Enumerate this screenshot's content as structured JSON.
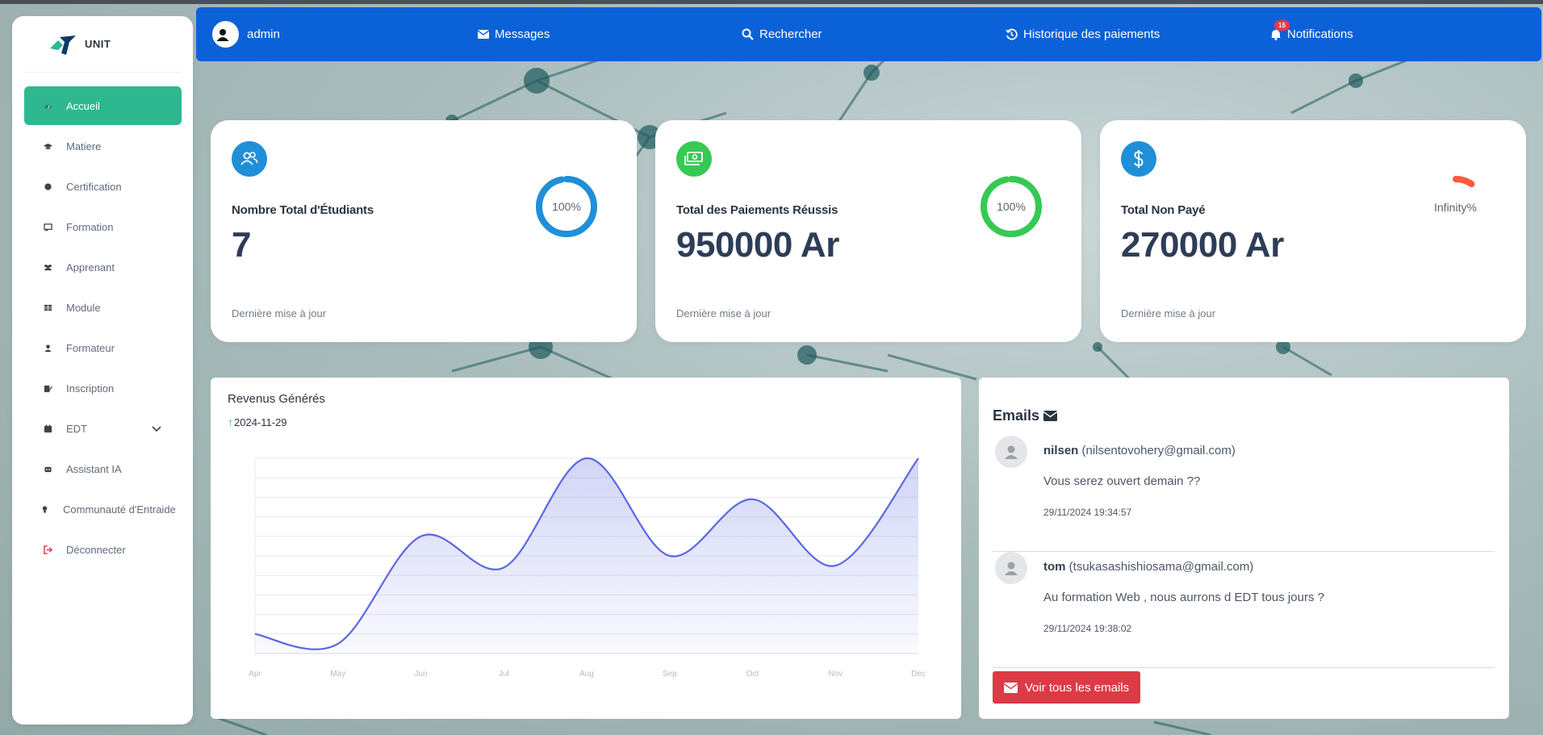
{
  "app": {
    "brand": "UNIT"
  },
  "sidebar": {
    "items": [
      {
        "label": "Accueil",
        "icon": "dashboard-icon",
        "active": true
      },
      {
        "label": "Matiere",
        "icon": "graduation-cap-icon"
      },
      {
        "label": "Certification",
        "icon": "certificate-icon"
      },
      {
        "label": "Formation",
        "icon": "chalkboard-icon"
      },
      {
        "label": "Apprenant",
        "icon": "users-icon"
      },
      {
        "label": "Module",
        "icon": "table-icon"
      },
      {
        "label": "Formateur",
        "icon": "user-icon"
      },
      {
        "label": "Inscription",
        "icon": "edit-icon"
      },
      {
        "label": "EDT",
        "icon": "calendar-icon",
        "has_submenu": true
      },
      {
        "label": "Assistant IA",
        "icon": "robot-icon"
      },
      {
        "label": "Communauté d'Entraide",
        "icon": "lightbulb-icon"
      },
      {
        "label": "Déconnecter",
        "icon": "sign-out-icon"
      }
    ]
  },
  "topbar": {
    "user": "admin",
    "messages": "Messages",
    "search": "Rechercher",
    "payments_history": "Historique des paiements",
    "notifications": "Notifications",
    "notifications_count": "15"
  },
  "stats": [
    {
      "title": "Nombre Total d'Étudiants",
      "value": "7",
      "ring_label": "100%",
      "ring_fraction": 1.0,
      "footer": "Dernière mise à jour",
      "color": "#1f8fd8",
      "icon": "users-icon"
    },
    {
      "title": "Total des Paiements Réussis",
      "value": "950000 Ar",
      "ring_label": "100%",
      "ring_fraction": 1.0,
      "footer": "Dernière mise à jour",
      "color": "#36c953",
      "icon": "money-bill-icon"
    },
    {
      "title": "Total Non Payé",
      "value": "270000 Ar",
      "ring_label": "Infinity%",
      "ring_fraction": 0.1,
      "footer": "Dernière mise à jour",
      "color": "#ff5a3a",
      "icon": "dollar-icon",
      "icon_color": "#1f8fd8"
    }
  ],
  "revenue": {
    "title": "Revenus Générés",
    "date": "2024-11-29"
  },
  "chart_data": {
    "type": "area",
    "categories": [
      "Apr",
      "May",
      "Jun",
      "Jul",
      "Aug",
      "Sep",
      "Oct",
      "Nov",
      "Dec"
    ],
    "values": [
      10,
      5,
      60,
      44,
      100,
      50,
      79,
      45,
      100
    ],
    "ylim": [
      0,
      100
    ],
    "grid": true,
    "line_color": "#5b67e0"
  },
  "emails": {
    "title": "Emails",
    "items": [
      {
        "name": "nilsen",
        "address": "(nilsentovohery@gmail.com)",
        "message": "Vous serez ouvert demain ??",
        "date": "29/11/2024 19:34:57"
      },
      {
        "name": "tom",
        "address": "(tsukasashishiosama@gmail.com)",
        "message": "Au formation Web , nous aurrons d EDT tous jours ?",
        "date": "29/11/2024 19:38:02"
      }
    ],
    "view_all": "Voir tous les emails"
  }
}
